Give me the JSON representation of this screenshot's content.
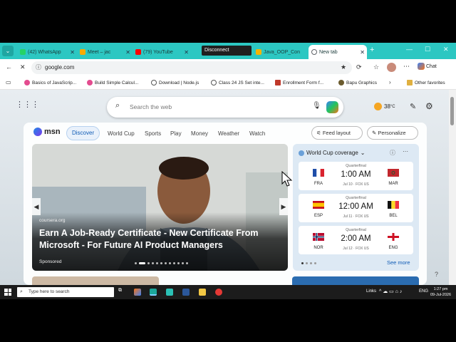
{
  "tabs": [
    {
      "title": "(42) WhatsApp",
      "color": "#25d366"
    },
    {
      "title": "Meet – jac",
      "color": "#f9ab00"
    },
    {
      "title": "(79) YouTube",
      "color": "#ff0000"
    },
    {
      "title": "Java_OOP_Con",
      "color": "#f4b400"
    },
    {
      "title": "New tab",
      "color": "#5f6368"
    }
  ],
  "disconnect_label": "Disconnect",
  "address": {
    "url": "google.com"
  },
  "chat_label": "Chat",
  "bookmarks": [
    {
      "label": "Basics of JavaScrip...",
      "color": "#e34c8f"
    },
    {
      "label": "Build Simple Calcul...",
      "color": "#e34c8f"
    },
    {
      "label": "Download | Node.js",
      "color": "#555"
    },
    {
      "label": "Class 24 JS Set inte...",
      "color": "#555"
    },
    {
      "label": "Enrollment Form f...",
      "color": "#c0392b"
    },
    {
      "label": "Bapu Graphics",
      "color": "#6b5b2e"
    },
    {
      "label": "Other favorites",
      "color": "#e0b040"
    }
  ],
  "search": {
    "placeholder": "Search the web"
  },
  "weather": {
    "temp": "38",
    "unit": "°C"
  },
  "feed": {
    "logo": "msn",
    "nav": [
      "Discover",
      "World Cup",
      "Sports",
      "Play",
      "Money",
      "Weather",
      "Watch"
    ],
    "feed_layout": "Feed layout",
    "personalize": "Personalize"
  },
  "hero": {
    "source": "coursera.org",
    "title": "Earn A Job-Ready Certificate - New Certificate From Microsoft - For Future AI Product Managers",
    "badge": "Sponsored"
  },
  "world_cup": {
    "title": "World Cup coverage",
    "see_more": "See more",
    "matches": [
      {
        "stage": "Quarterfinal",
        "time": "1:00 AM",
        "info": "Jul 10 · FOX US",
        "home": "FRA",
        "away": "MAR"
      },
      {
        "stage": "Quarterfinal",
        "time": "12:00 AM",
        "info": "Jul 11 · FOX US",
        "home": "ESP",
        "away": "BEL"
      },
      {
        "stage": "Quarterfinal",
        "time": "2:00 AM",
        "info": "Jul 12 · FOX US",
        "home": "NOR",
        "away": "ENG"
      }
    ]
  },
  "taskbar": {
    "search_placeholder": "Type here to search",
    "links": "Links",
    "lang": "ENG",
    "time": "1:27 pm",
    "date": "09-Jul-2026"
  }
}
